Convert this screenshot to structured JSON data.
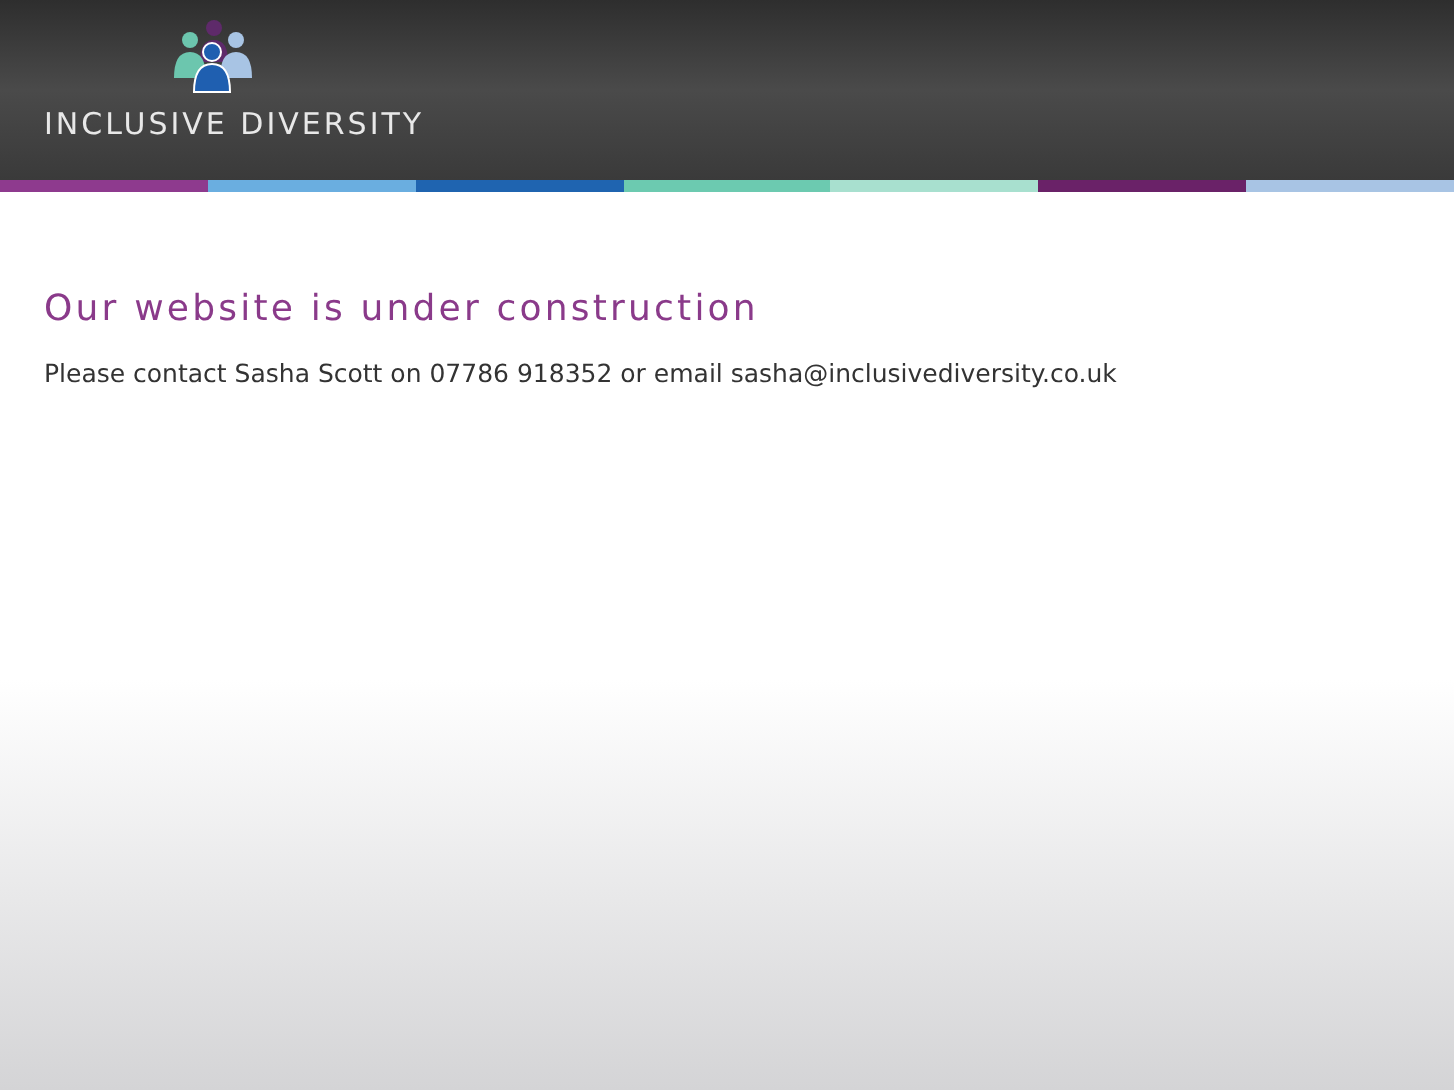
{
  "header": {
    "logo_text": "INCLUSIVE DIVERSITY"
  },
  "stripes": [
    {
      "color": "#8e3a8e"
    },
    {
      "color": "#6aaee0"
    },
    {
      "color": "#1f64b0"
    },
    {
      "color": "#6ccab0"
    },
    {
      "color": "#a8e0cf"
    },
    {
      "color": "#6a2268"
    },
    {
      "color": "#a8c4e4"
    }
  ],
  "main": {
    "heading": "Our website is under construction",
    "message": "Please contact Sasha Scott on 07786 918352 or email sasha@inclusivediversity.co.uk"
  }
}
